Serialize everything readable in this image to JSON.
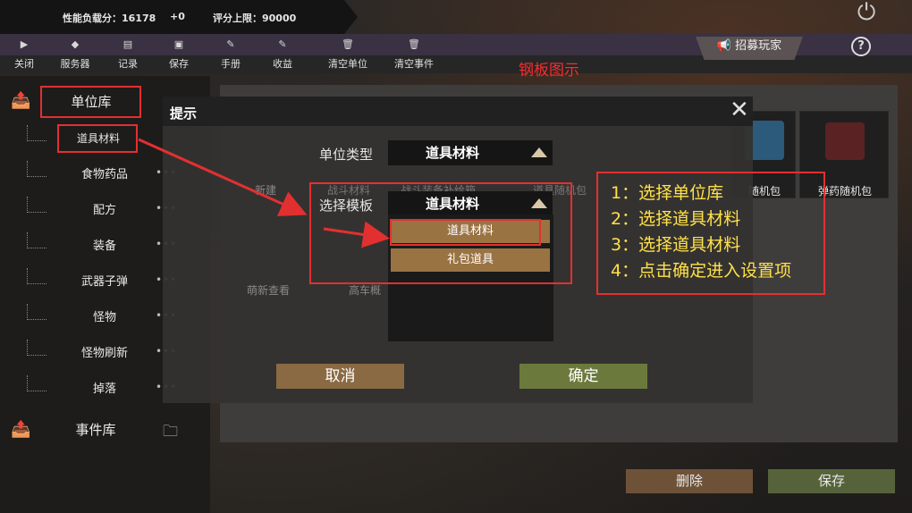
{
  "status": {
    "perf_load_label": "性能负载分：16178",
    "perf_delta": "+0",
    "score_limit": "评分上限：90000"
  },
  "toolbar": [
    {
      "label": "关闭",
      "icon": "play-icon"
    },
    {
      "label": "服务器",
      "icon": "cube-icon"
    },
    {
      "label": "记录",
      "icon": "doc-icon"
    },
    {
      "label": "保存",
      "icon": "disk-icon"
    },
    {
      "label": "手册",
      "icon": "edit-icon"
    },
    {
      "label": "收益",
      "icon": "edit-icon"
    },
    {
      "label": "清空单位",
      "icon": "trash-icon"
    },
    {
      "label": "清空事件",
      "icon": "trash-icon"
    }
  ],
  "recruit_label": "招募玩家",
  "banner_title": "钢板图示",
  "sidebar": {
    "unit_lib": "单位库",
    "event_lib": "事件库",
    "items": [
      "道具材料",
      "食物药品",
      "配方",
      "装备",
      "武器子弹",
      "怪物",
      "怪物刷新",
      "掉落"
    ]
  },
  "cards": [
    {
      "label": "弹药随机包",
      "icon": "ammo-icon"
    }
  ],
  "bg_fragments": {
    "card_a": "随机包",
    "card_b": "新建",
    "card_c": "战斗材料",
    "card_d": "战斗装备补给箱",
    "card_e": "道具随机包",
    "card_f": "萌新查看",
    "card_g": "高车概"
  },
  "dialog": {
    "title": "提示",
    "unit_type_label": "单位类型",
    "unit_type_value": "道具材料",
    "template_label": "选择模板",
    "template_value": "道具材料",
    "options": [
      "道具材料",
      "礼包道具"
    ],
    "cancel": "取消",
    "confirm": "确定"
  },
  "instructions": [
    "1：选择单位库",
    "2：选择道具材料",
    "3：选择道具材料",
    "4：点击确定进入设置项"
  ],
  "bottom": {
    "delete": "删除",
    "save": "保存"
  },
  "colors": {
    "annotation_red": "#e23030",
    "instruction_yellow": "#ffe14a",
    "cancel_btn": "#8a6a43",
    "confirm_btn": "#6b7a3c"
  }
}
